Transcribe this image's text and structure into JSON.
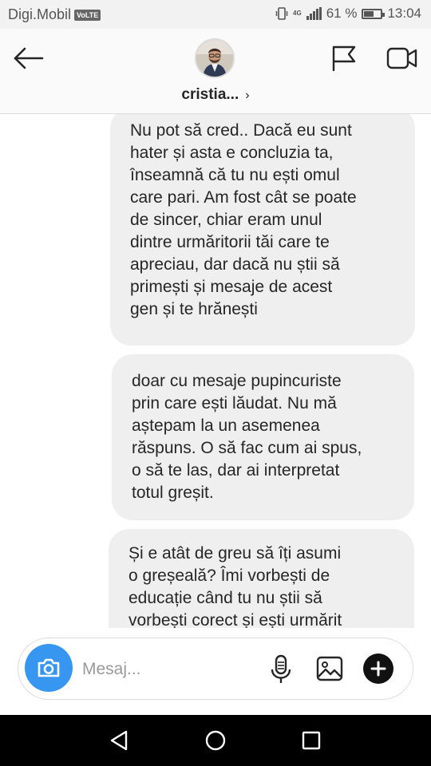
{
  "status_bar": {
    "carrier": "Digi.Mobil",
    "volte": "VoLTE",
    "network": "4G",
    "battery_text": "61 %",
    "battery_level": 0.61,
    "time": "13:04"
  },
  "header": {
    "username": "cristia...",
    "chevron": "›",
    "icons": [
      "back-arrow-icon",
      "flag-icon",
      "video-call-icon"
    ]
  },
  "messages": [
    {
      "text": "Nu pot să cred.. Dacă eu sunt\nhater și asta e concluzia ta,\nînseamnă că tu nu ești omul\ncare pari. Am fost cât se poate\nde sincer, chiar eram unul\ndintre urmăritorii tăi care te\napreciau, dar dacă nu știi să\nprimești și mesaje de acest\ngen și te hrănești"
    },
    {
      "text": "doar cu mesaje pupincuriste\nprin care ești lăudat. Nu mă\naștepam la un asemenea\nrăspuns. O să fac cum ai spus,\no să te las, dar ai interpretat\ntotul greșit."
    },
    {
      "text": "Și e atât de greu să îți asumi\no greșeală? Îmi vorbești de\neducație când tu nu știi să\nvorbești corect și ești urmărit"
    }
  ],
  "composer": {
    "placeholder": "Mesaj...",
    "value": "",
    "accent": "#3797f0",
    "icons": [
      "camera-icon",
      "microphone-icon",
      "gallery-icon",
      "plus-icon"
    ]
  },
  "nav_bar": {
    "icons": [
      "nav-back-icon",
      "nav-home-icon",
      "nav-recent-apps-icon"
    ]
  }
}
